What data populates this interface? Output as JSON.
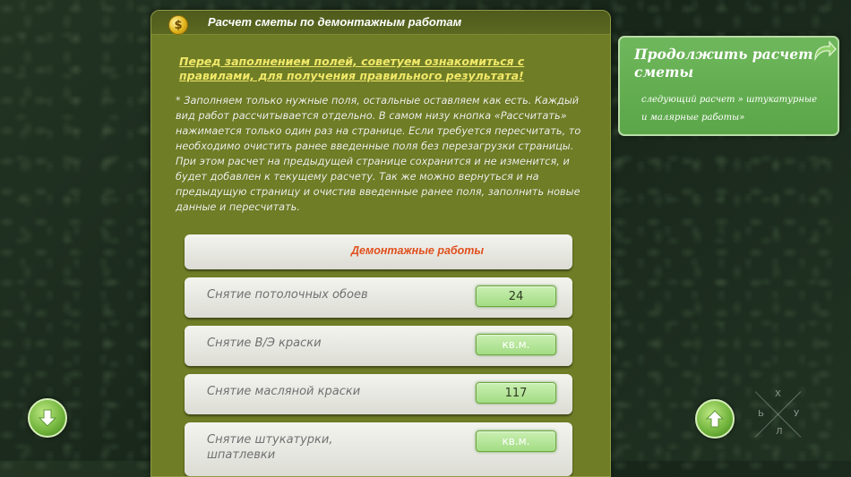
{
  "panel": {
    "title": "Расчет сметы по демонтажным работам",
    "coin_symbol": "$",
    "warning_link": "Перед заполнением полей, советуем ознакомиться с правилами, для получения правильного результата!",
    "instructions": "* Заполняем только нужные поля, остальные оставляем как есть. Каждый вид работ рассчитывается отдельно. В самом низу кнопка «Рассчитать» нажимается только один раз на странице. Если требуется пересчитать, то необходимо очистить ранее введенные поля без перезагрузки страницы. При этом расчет на предыдущей странице сохранится и не изменится, и будет добавлен к текущему расчету. Так же можно вернуться и на предыдущую страницу и очистив введенные ранее поля, заполнить новые данные и пересчитать."
  },
  "section": {
    "title": "Демонтажные работы"
  },
  "rows": [
    {
      "label": "Снятие потолочных обоев",
      "value": "24",
      "placeholder": "кв.м."
    },
    {
      "label": "Снятие В/Э краски",
      "value": "",
      "placeholder": "кв.м."
    },
    {
      "label": "Снятие масляной краски",
      "value": "117",
      "placeholder": "кв.м."
    },
    {
      "label": "Снятие штукатурки, шпатлевки",
      "value": "",
      "placeholder": "кв.м."
    }
  ],
  "next_card": {
    "title": "Продолжить расчет сметы",
    "subtitle": "следующий расчет » штукатурные и малярные работы»"
  },
  "logo": {
    "letters": [
      "Х",
      "Ь",
      "У",
      "Л"
    ]
  },
  "colors": {
    "panel": "#6f7d26",
    "panel_header": "#4e5a1c",
    "section_title": "#e0501d",
    "warning_link": "#f2e96a",
    "next_card": "#5aa648",
    "input_green": "#a3dc84"
  },
  "icons": {
    "coin": "coin-icon",
    "down": "arrow-down-icon",
    "up": "arrow-up-icon",
    "redo": "redo-arrow-icon"
  }
}
